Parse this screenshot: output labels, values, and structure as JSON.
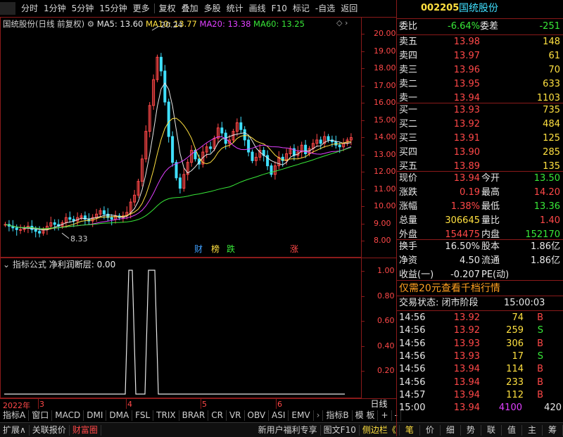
{
  "toolbar": {
    "items": [
      "分时",
      "1分钟",
      "5分钟",
      "15分钟",
      "更多",
      "复权",
      "叠加",
      "多股",
      "统计",
      "画线",
      "F10",
      "标记",
      "-自选",
      "返回"
    ]
  },
  "stock": {
    "code": "002205",
    "name": "国统股份"
  },
  "chart": {
    "title": "国统股份(日线 前复权)",
    "ma5": "MA5: 13.60",
    "ma10": "MA10: 13.77",
    "ma20": "MA20: 13.38",
    "ma60": "MA60: 13.25",
    "high_label": "20.24",
    "low_label": "8.33",
    "y_ticks": [
      "20.00",
      "19.00",
      "18.00",
      "17.00",
      "16.00",
      "15.00",
      "14.00",
      "13.00",
      "12.00",
      "11.00",
      "10.00",
      "9.00",
      "8.00"
    ],
    "markers": [
      {
        "text": "财",
        "color": "#40a0ff"
      },
      {
        "text": "榜",
        "color": "#ffe040"
      },
      {
        "text": "跌",
        "color": "#38e838"
      },
      {
        "text": "涨",
        "color": "#ff4848"
      }
    ],
    "colors": {
      "ma5": "#e8e8e8",
      "ma10": "#ffe040",
      "ma20": "#e040ff",
      "ma60": "#38e838",
      "up": "#ff4848",
      "down": "#40e0ff"
    }
  },
  "indicator": {
    "title": "指标公式",
    "formula": "净利润断层: 0.00",
    "y_ticks": [
      "1.00",
      "0.80",
      "0.60",
      "0.40",
      "0.20"
    ]
  },
  "xaxis": {
    "year": "2022年",
    "months": [
      "3",
      "4",
      "5",
      "6"
    ],
    "period": "日线"
  },
  "tabs": [
    "指标A",
    "窗口",
    "MACD",
    "DMI",
    "DMA",
    "FSL",
    "TRIX",
    "BRAR",
    "CR",
    "VR",
    "OBV",
    "ASI",
    "EMV"
  ],
  "tabs_right": [
    "指标B",
    "模 板",
    "+",
    "-"
  ],
  "bottom": {
    "left": [
      "扩展∧",
      "关联报价",
      "财富圈"
    ],
    "mid": [
      "新用户福利专享",
      "图文F10",
      "侧边栏《"
    ],
    "right": [
      "笔",
      "价",
      "细",
      "势",
      "联",
      "值",
      "主",
      "筹"
    ]
  },
  "quote": {
    "wb_label": "委比",
    "wb": "-6.64%",
    "wc_label": "委差",
    "wc": "-251",
    "sells": [
      {
        "label": "卖五",
        "price": "13.98",
        "vol": "148"
      },
      {
        "label": "卖四",
        "price": "13.97",
        "vol": "61"
      },
      {
        "label": "卖三",
        "price": "13.96",
        "vol": "70"
      },
      {
        "label": "卖二",
        "price": "13.95",
        "vol": "633"
      },
      {
        "label": "卖一",
        "price": "13.94",
        "vol": "1103"
      }
    ],
    "buys": [
      {
        "label": "买一",
        "price": "13.93",
        "vol": "735"
      },
      {
        "label": "买二",
        "price": "13.92",
        "vol": "484"
      },
      {
        "label": "买三",
        "price": "13.91",
        "vol": "125"
      },
      {
        "label": "买四",
        "price": "13.90",
        "vol": "285"
      },
      {
        "label": "买五",
        "price": "13.89",
        "vol": "135"
      }
    ],
    "stats": [
      {
        "l1": "现价",
        "v1": "13.94",
        "l2": "今开",
        "v2": "13.50"
      },
      {
        "l1": "涨跌",
        "v1": "0.19",
        "l2": "最高",
        "v2": "14.20"
      },
      {
        "l1": "涨幅",
        "v1": "1.38%",
        "l2": "最低",
        "v2": "13.36"
      },
      {
        "l1": "总量",
        "v1": "306645",
        "l2": "量比",
        "v2": "1.40"
      },
      {
        "l1": "外盘",
        "v1": "154475",
        "l2": "内盘",
        "v2": "152170"
      }
    ],
    "stats2": [
      {
        "l1": "换手",
        "v1": "16.50%",
        "l2": "股本",
        "v2": "1.86亿"
      },
      {
        "l1": "净资",
        "v1": "4.50",
        "l2": "流通",
        "v2": "1.86亿"
      },
      {
        "l1": "收益(一)",
        "v1": "-0.207",
        "l2": "PE(动)",
        "v2": ""
      }
    ],
    "promo": "仅需20元查看千档行情",
    "trade_state": "交易状态: 闭市阶段",
    "trade_time": "15:00:03",
    "ticks": [
      {
        "t": "14:56",
        "p": "13.92",
        "v": "74",
        "d": "B"
      },
      {
        "t": "14:56",
        "p": "13.92",
        "v": "259",
        "d": "S"
      },
      {
        "t": "14:56",
        "p": "13.93",
        "v": "306",
        "d": "B"
      },
      {
        "t": "14:56",
        "p": "13.93",
        "v": "17",
        "d": "S"
      },
      {
        "t": "14:56",
        "p": "13.94",
        "v": "114",
        "d": "B"
      },
      {
        "t": "14:56",
        "p": "13.94",
        "v": "233",
        "d": "B"
      },
      {
        "t": "14:57",
        "p": "13.94",
        "v": "112",
        "d": "B"
      },
      {
        "t": "15:00",
        "p": "13.94",
        "v": "4100",
        "d": "420"
      }
    ]
  }
}
